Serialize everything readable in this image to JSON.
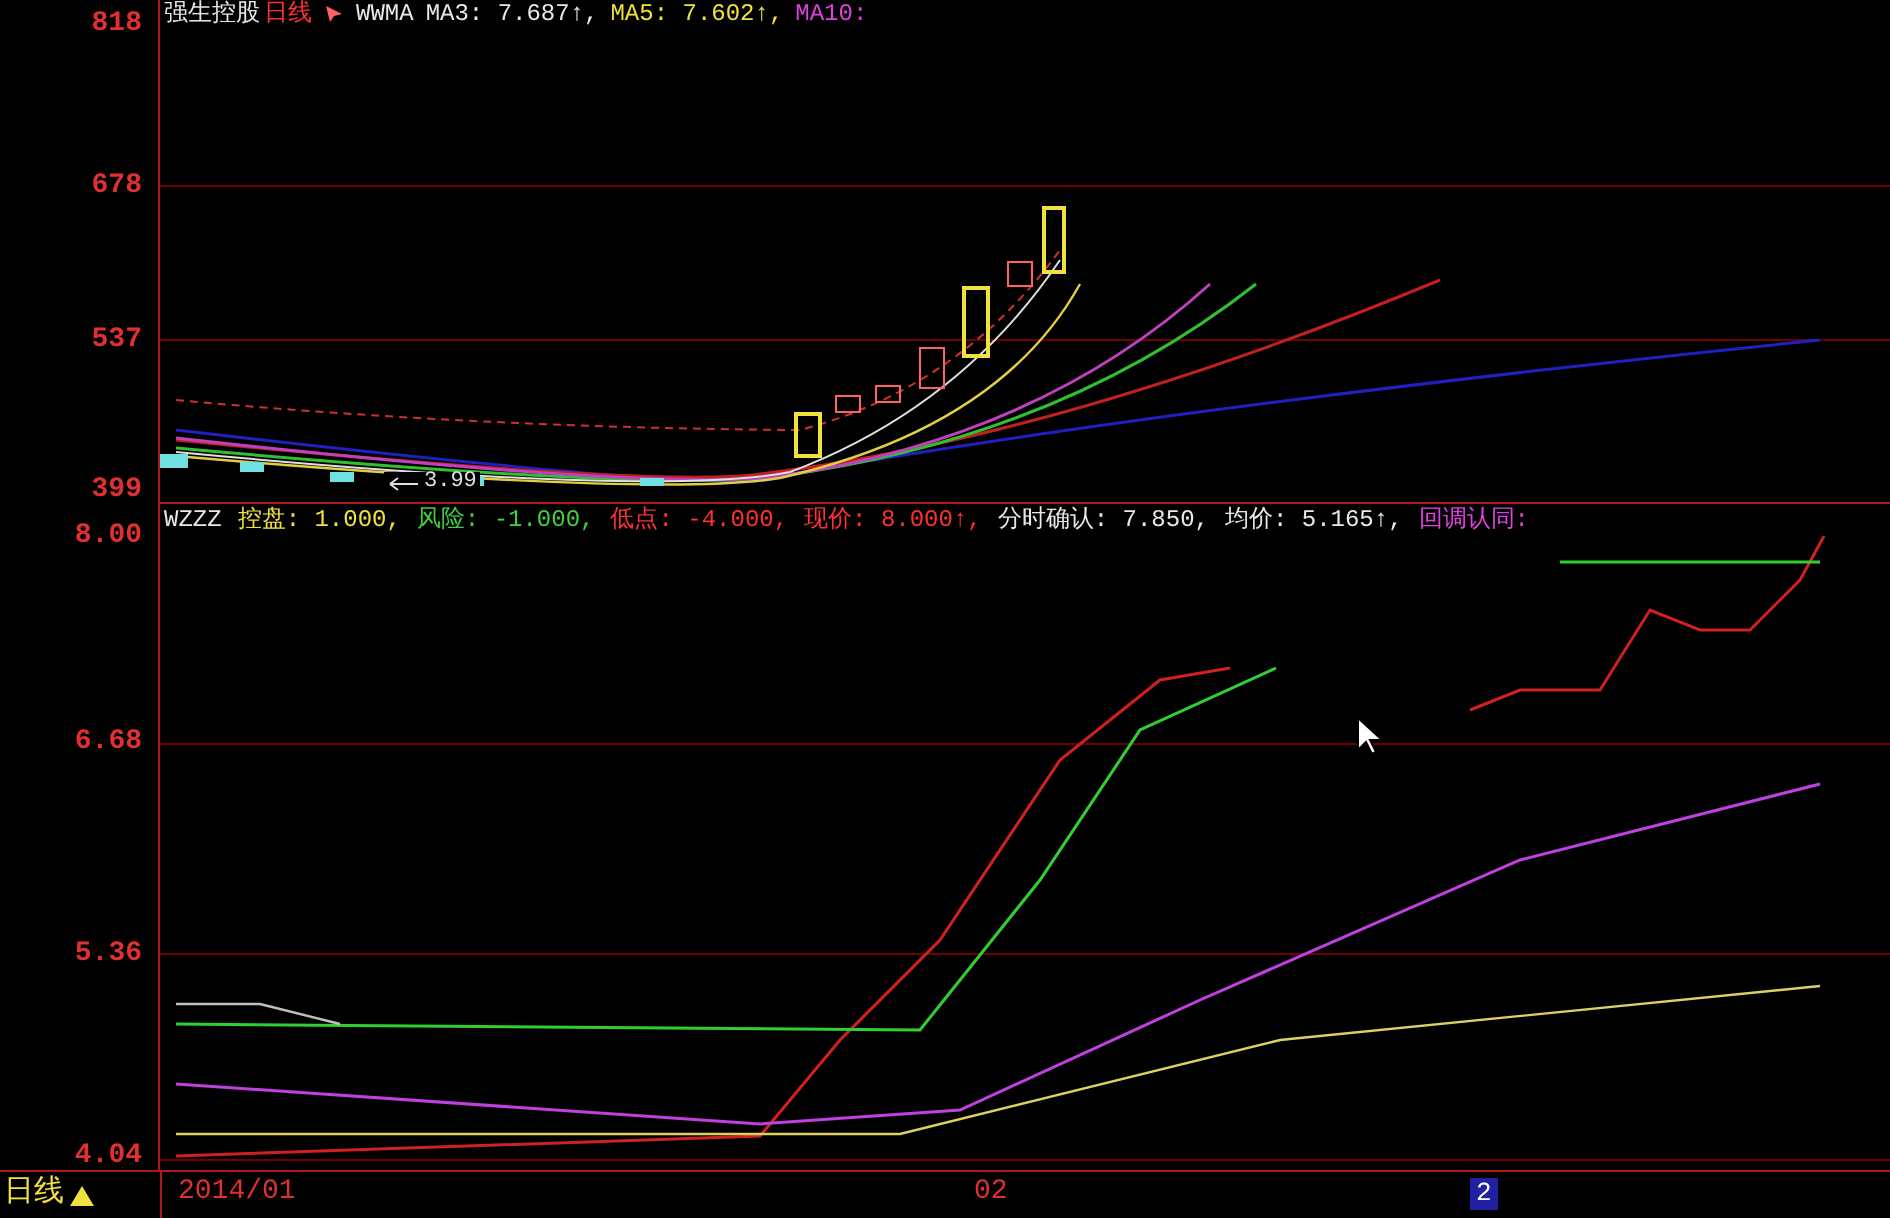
{
  "price_pane": {
    "title": [
      {
        "text": "强生控股",
        "color": "#e8e8e8"
      },
      {
        "text": "日线",
        "color": "#ff3030"
      }
    ],
    "indicator": [
      {
        "text": "WWMA",
        "color": "#e8e8e8"
      },
      {
        "text": "MA3: 7.687↑,",
        "color": "#e8e8e8"
      },
      {
        "text": "MA5: 7.602↑,",
        "color": "#f0e040"
      },
      {
        "text": "MA10:",
        "color": "#e040e0"
      }
    ],
    "low_marker": "3.99",
    "y_ticks": [
      "818",
      "678",
      "537",
      "399"
    ]
  },
  "indicator_pane": {
    "header": [
      {
        "text": "WZZZ",
        "color": "#e8e8e8"
      },
      {
        "text": "控盘: 1.000,",
        "color": "#f0e040"
      },
      {
        "text": "风险: -1.000,",
        "color": "#40d040"
      },
      {
        "text": "低点: -4.000,",
        "color": "#ff3030"
      },
      {
        "text": "现价: 8.000↑,",
        "color": "#ff3030"
      },
      {
        "text": "分时确认: 7.850,",
        "color": "#e8e8e8"
      },
      {
        "text": "均价: 5.165↑,",
        "color": "#e8e8e8"
      },
      {
        "text": "回调认同:",
        "color": "#e040e0"
      }
    ],
    "y_ticks": [
      "8.00",
      "6.68",
      "5.36",
      "4.04"
    ]
  },
  "bottom_bar": {
    "period": "日线",
    "dates": [
      "2014/01",
      "02"
    ],
    "page": "2"
  }
}
